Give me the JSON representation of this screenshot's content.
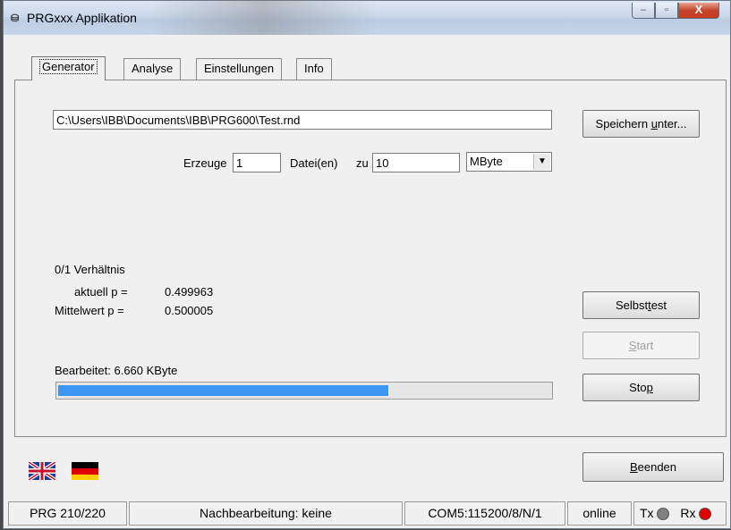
{
  "window": {
    "title": "PRGxxx Applikation",
    "icon_text": "⛁",
    "min": "–",
    "max": "▫",
    "close": "X"
  },
  "tabs": [
    {
      "label": "Generator"
    },
    {
      "label": "Analyse"
    },
    {
      "label": "Einstellungen"
    },
    {
      "label": "Info"
    }
  ],
  "generator": {
    "file_path": "C:\\Users\\IBB\\Documents\\IBB\\PRG600\\Test.rnd",
    "save_as": {
      "pre": "Speichern ",
      "u": "u",
      "post": "nter..."
    },
    "erzeuge_label": "Erzeuge",
    "count": "1",
    "files_label": "Datei(en)",
    "zu_label": "zu",
    "size": "10",
    "unit": "MByte",
    "ratio_title": "0/1 Verhältnis",
    "current_label": "aktuell p =",
    "current_value": "0.499963",
    "mean_label": "Mittelwert p =",
    "mean_value": "0.500005",
    "processed": "Bearbeitet:  6.660 KByte",
    "progress_fraction": 0.67,
    "selftest": {
      "pre": "Selbst",
      "u": "t",
      "post": "est"
    },
    "start": {
      "pre": "",
      "u": "S",
      "post": "tart"
    },
    "stop": {
      "pre": "Sto",
      "u": "p",
      "post": ""
    }
  },
  "quit": {
    "pre": "",
    "u": "B",
    "post": "eenden"
  },
  "status": {
    "device": "PRG 210/220",
    "postprocessing": "Nachbearbeitung: keine",
    "port": "COM5:115200/8/N/1",
    "online": "online",
    "tx": "Tx",
    "rx": "Rx"
  },
  "colors": {
    "tx_led": "#808080",
    "rx_led": "#e00000",
    "progress": "#3a96f0"
  },
  "icons": [
    "app-icon",
    "flag-uk-icon",
    "flag-germany-icon",
    "led-tx-icon",
    "led-rx-icon",
    "dropdown-arrow-icon"
  ]
}
